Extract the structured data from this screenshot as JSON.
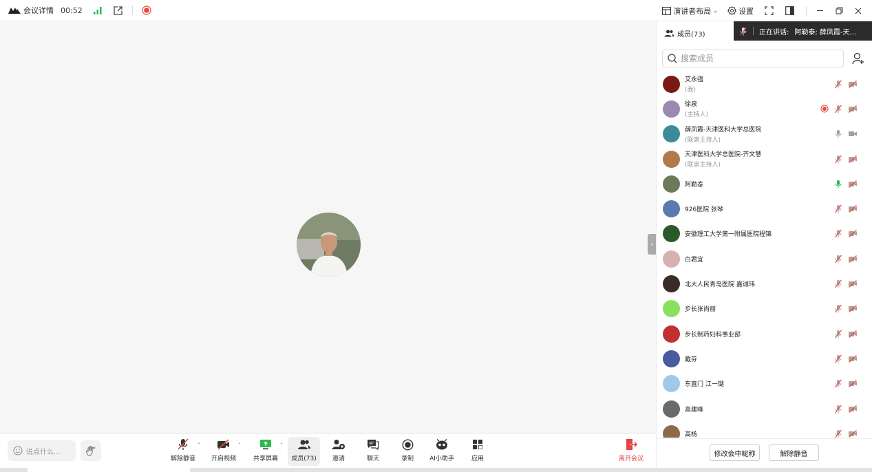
{
  "titlebar": {
    "meeting_details": "会议详情",
    "duration": "00:52",
    "layout_label": "演讲者布局",
    "settings_label": "设置"
  },
  "stage": {
    "collapse_glyph": "‹"
  },
  "toolbar": {
    "say_placeholder": "说点什么...",
    "unmute": "解除静音",
    "start_video": "开启视频",
    "share_screen": "共享屏幕",
    "members": "成员(73)",
    "invite": "邀请",
    "chat": "聊天",
    "record": "录制",
    "ai_assistant": "AI小助手",
    "apps": "应用",
    "leave": "离开会议"
  },
  "panel": {
    "title": "成员(73)",
    "speaking_label": "正在讲话:",
    "speaking_names": "阿勒泰; 薛凤霞-天...",
    "search_placeholder": "搜索成员",
    "rename_button": "修改会中昵称",
    "unmute_button": "解除静音",
    "members": [
      {
        "name": "艾永强",
        "role": "(我)",
        "mic": "muted",
        "cam": "off",
        "recording": false,
        "avatar_color": "#7a1a14"
      },
      {
        "name": "徐泉",
        "role": "(主持人)",
        "mic": "muted",
        "cam": "off",
        "recording": true,
        "avatar_color": "#9a8ab0"
      },
      {
        "name": "薛凤霞-天津医科大学总医院",
        "role": "(联席主持人)",
        "mic": "on",
        "cam": "on",
        "recording": false,
        "avatar_color": "#3a8a9a"
      },
      {
        "name": "天津医科大学总医院-齐文慧",
        "role": "(联席主持人)",
        "mic": "muted",
        "cam": "off",
        "recording": false,
        "avatar_color": "#b07a4a"
      },
      {
        "name": "阿勒泰",
        "role": "",
        "mic": "speaking",
        "cam": "off",
        "recording": false,
        "avatar_color": "#6a7a5a"
      },
      {
        "name": "926医院 张琴",
        "role": "",
        "mic": "muted",
        "cam": "off",
        "recording": false,
        "avatar_color": "#5a7ab0"
      },
      {
        "name": "安徽理工大学第一附属医院程锦",
        "role": "",
        "mic": "muted",
        "cam": "off",
        "recording": false,
        "avatar_color": "#2a5a2a"
      },
      {
        "name": "白君宜",
        "role": "",
        "mic": "muted",
        "cam": "off",
        "recording": false,
        "avatar_color": "#d8b0b0"
      },
      {
        "name": "北大人民青岛医院 嘉诚玮",
        "role": "",
        "mic": "muted",
        "cam": "off",
        "recording": false,
        "avatar_color": "#3a2a2a"
      },
      {
        "name": "步长张尚丽",
        "role": "",
        "mic": "muted",
        "cam": "off",
        "recording": false,
        "avatar_color": "#8ae060"
      },
      {
        "name": "步长制药妇科事业部",
        "role": "",
        "mic": "muted",
        "cam": "off",
        "recording": false,
        "avatar_color": "#c03030"
      },
      {
        "name": "戴芬",
        "role": "",
        "mic": "muted",
        "cam": "off",
        "recording": false,
        "avatar_color": "#4a5aa0"
      },
      {
        "name": "东直门 江一璐",
        "role": "",
        "mic": "muted",
        "cam": "off",
        "recording": false,
        "avatar_color": "#a0c8e8"
      },
      {
        "name": "高建峰",
        "role": "",
        "mic": "muted",
        "cam": "off",
        "recording": false,
        "avatar_color": "#6a6a6a"
      },
      {
        "name": "高杨",
        "role": "",
        "mic": "muted",
        "cam": "off",
        "recording": false,
        "avatar_color": "#8a6a4a"
      }
    ]
  },
  "colors": {
    "accent_green": "#2db84d",
    "record_red": "#e84a3a",
    "leave_red": "#e64340",
    "muted_icon": "#b0a0a0"
  }
}
